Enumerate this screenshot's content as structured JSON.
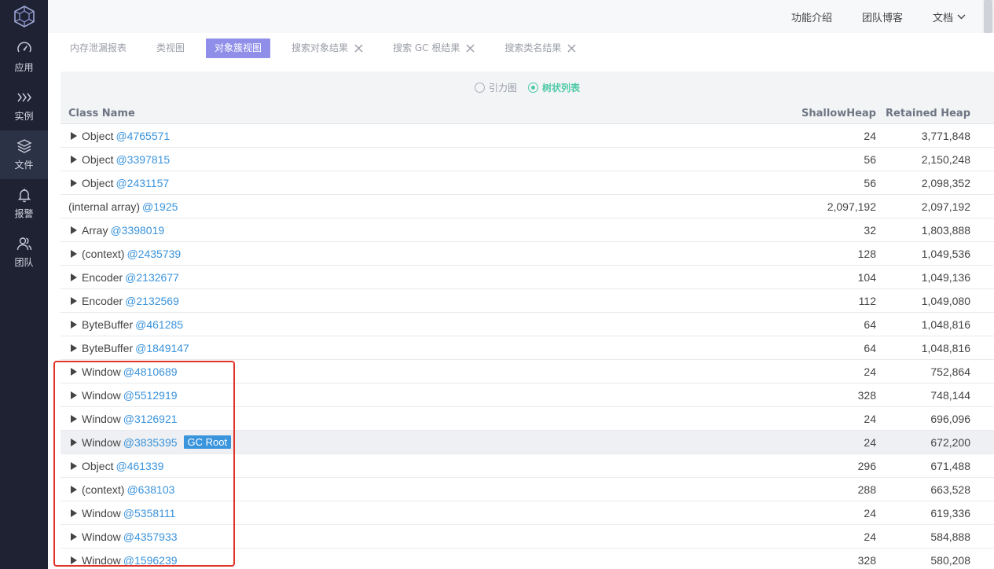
{
  "sidebar": {
    "items": [
      {
        "label": "应用",
        "icon": "gauge-icon"
      },
      {
        "label": "实例",
        "icon": "chevrons-right-icon"
      },
      {
        "label": "文件",
        "icon": "layers-icon"
      },
      {
        "label": "报警",
        "icon": "bell-icon"
      },
      {
        "label": "团队",
        "icon": "users-icon"
      }
    ],
    "active_index": 2
  },
  "topnav": {
    "items": [
      "功能介绍",
      "团队博客",
      "文档"
    ]
  },
  "tabs": [
    {
      "label": "内存泄漏报表",
      "closable": false,
      "active": false
    },
    {
      "label": "类视图",
      "closable": false,
      "active": false
    },
    {
      "label": "对象簇视图",
      "closable": false,
      "active": true
    },
    {
      "label": "搜索对象结果",
      "closable": true,
      "active": false
    },
    {
      "label": "搜索 GC 根结果",
      "closable": true,
      "active": false
    },
    {
      "label": "搜索类名结果",
      "closable": true,
      "active": false
    }
  ],
  "view_toggle": {
    "options": [
      "引力图",
      "树状列表"
    ],
    "selected": "树状列表"
  },
  "table": {
    "headers": {
      "name": "Class Name",
      "shallow": "ShallowHeap",
      "retained": "Retained Heap"
    },
    "rows": [
      {
        "cls": "Object",
        "addr": "@4765571",
        "shallow": "24",
        "retained": "3,771,848",
        "expandable": true
      },
      {
        "cls": "Object",
        "addr": "@3397815",
        "shallow": "56",
        "retained": "2,150,248",
        "expandable": true
      },
      {
        "cls": "Object",
        "addr": "@2431157",
        "shallow": "56",
        "retained": "2,098,352",
        "expandable": true
      },
      {
        "cls": "(internal array)",
        "addr": "@1925",
        "shallow": "2,097,192",
        "retained": "2,097,192",
        "expandable": false
      },
      {
        "cls": "Array",
        "addr": "@3398019",
        "shallow": "32",
        "retained": "1,803,888",
        "expandable": true
      },
      {
        "cls": "(context)",
        "addr": "@2435739",
        "shallow": "128",
        "retained": "1,049,536",
        "expandable": true
      },
      {
        "cls": "Encoder",
        "addr": "@2132677",
        "shallow": "104",
        "retained": "1,049,136",
        "expandable": true
      },
      {
        "cls": "Encoder",
        "addr": "@2132569",
        "shallow": "112",
        "retained": "1,049,080",
        "expandable": true
      },
      {
        "cls": "ByteBuffer",
        "addr": "@461285",
        "shallow": "64",
        "retained": "1,048,816",
        "expandable": true
      },
      {
        "cls": "ByteBuffer",
        "addr": "@1849147",
        "shallow": "64",
        "retained": "1,048,816",
        "expandable": true
      },
      {
        "cls": "Window",
        "addr": "@4810689",
        "shallow": "24",
        "retained": "752,864",
        "expandable": true
      },
      {
        "cls": "Window",
        "addr": "@5512919",
        "shallow": "328",
        "retained": "748,144",
        "expandable": true
      },
      {
        "cls": "Window",
        "addr": "@3126921",
        "shallow": "24",
        "retained": "696,096",
        "expandable": true
      },
      {
        "cls": "Window",
        "addr": "@3835395",
        "shallow": "24",
        "retained": "672,200",
        "expandable": true,
        "badge": "GC Root",
        "highlight": true
      },
      {
        "cls": "Object",
        "addr": "@461339",
        "shallow": "296",
        "retained": "671,488",
        "expandable": true
      },
      {
        "cls": "(context)",
        "addr": "@638103",
        "shallow": "288",
        "retained": "663,528",
        "expandable": true
      },
      {
        "cls": "Window",
        "addr": "@5358111",
        "shallow": "24",
        "retained": "619,336",
        "expandable": true
      },
      {
        "cls": "Window",
        "addr": "@4357933",
        "shallow": "24",
        "retained": "584,888",
        "expandable": true
      },
      {
        "cls": "Window",
        "addr": "@1596239",
        "shallow": "328",
        "retained": "580,208",
        "expandable": true
      }
    ]
  },
  "colors": {
    "sidebar_bg": "#1e2233",
    "active_tab": "#8f8ee8",
    "link": "#3a93dc",
    "radio_checked": "#4dc9a5",
    "annotation_box": "#e2332b"
  }
}
